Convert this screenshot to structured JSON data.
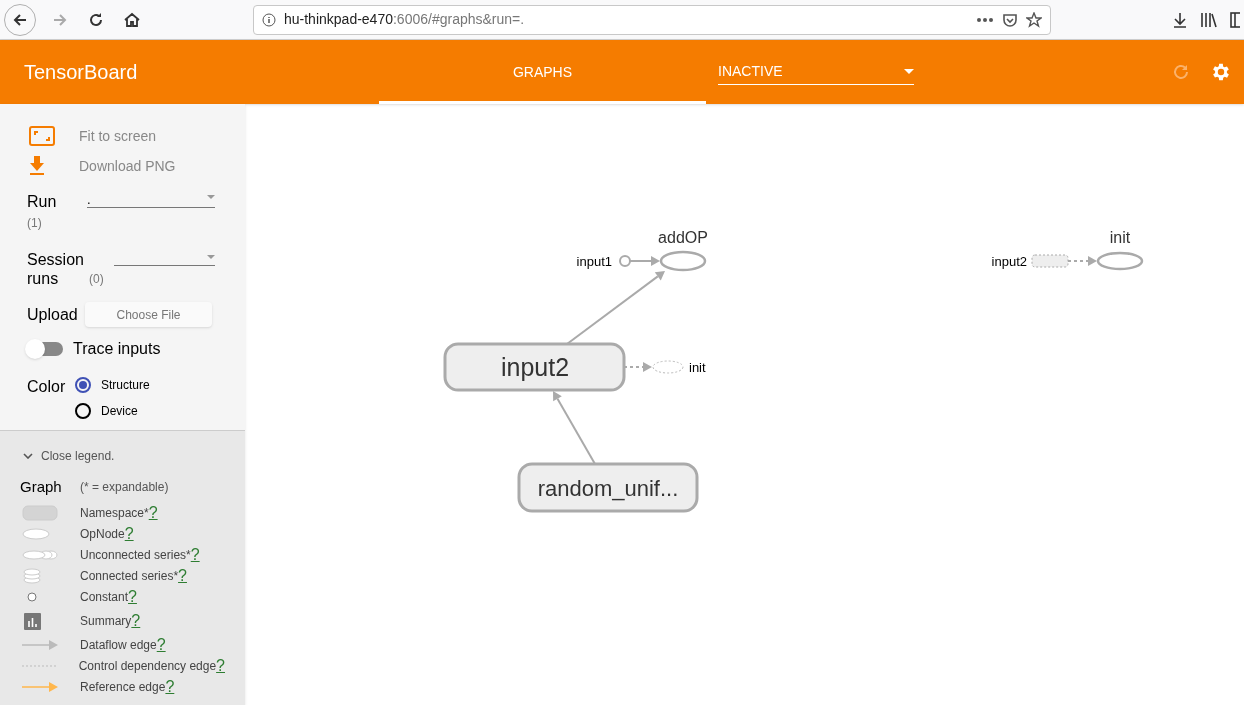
{
  "browser": {
    "url_host": "hu-thinkpad-e470",
    "url_rest": ":6006/#graphs&run=."
  },
  "header": {
    "title": "TensorBoard",
    "tabs": [
      {
        "label": "GRAPHS",
        "selected": true
      }
    ],
    "run_select": "INACTIVE"
  },
  "sidebar": {
    "actions": [
      {
        "kind": "fit",
        "label": "Fit to screen"
      },
      {
        "kind": "download",
        "label": "Download PNG"
      }
    ],
    "run": {
      "label": "Run",
      "count": "(1)",
      "value": "."
    },
    "session_runs": {
      "label": "Session runs",
      "count": "(0)"
    },
    "upload": {
      "label": "Upload",
      "button": "Choose File"
    },
    "trace_inputs": {
      "label": "Trace inputs",
      "on": false
    },
    "color": {
      "label": "Color",
      "options": [
        {
          "label": "Structure",
          "selected": true
        },
        {
          "label": "Device",
          "selected": false
        }
      ]
    }
  },
  "legend": {
    "toggle": "Close legend.",
    "title": "Graph",
    "note": "(* = expandable)",
    "items": [
      {
        "kind": "namespace",
        "label": "Namespace*",
        "link": "?"
      },
      {
        "kind": "opnode",
        "label": "OpNode",
        "link": "?"
      },
      {
        "kind": "unconnected",
        "label": "Unconnected series*",
        "link": "?"
      },
      {
        "kind": "connected",
        "label": "Connected series*",
        "link": "?"
      },
      {
        "kind": "constant",
        "label": "Constant",
        "link": "?"
      },
      {
        "kind": "summary",
        "label": "Summary",
        "link": "?"
      },
      {
        "kind": "dataflow",
        "label": "Dataflow edge",
        "link": "?"
      },
      {
        "kind": "control",
        "label": "Control dependency edge",
        "link": "?"
      },
      {
        "kind": "reference",
        "label": "Reference edge",
        "link": "?"
      }
    ]
  },
  "graph": {
    "nodes": [
      {
        "kind": "op",
        "label": "addOP"
      },
      {
        "kind": "constant",
        "label": "input1"
      },
      {
        "kind": "namespace",
        "label": "input2"
      },
      {
        "kind": "op_control",
        "label": "init"
      },
      {
        "kind": "namespace",
        "label": "random_unif..."
      },
      {
        "kind": "op",
        "label": "init"
      },
      {
        "kind": "namespace_control",
        "label": "input2"
      }
    ]
  }
}
